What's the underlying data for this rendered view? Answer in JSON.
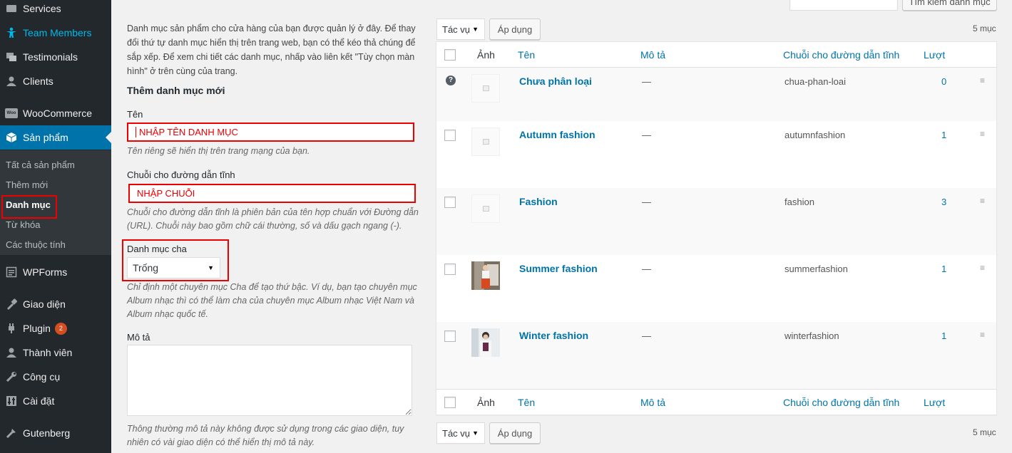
{
  "sidebar": {
    "items": [
      {
        "label": "Services",
        "icon": "services-icon"
      },
      {
        "label": "Team Members",
        "icon": "team-icon"
      },
      {
        "label": "Testimonials",
        "icon": "testimonials-icon"
      },
      {
        "label": "Clients",
        "icon": "clients-icon"
      },
      {
        "label": "WooCommerce",
        "icon": "woocommerce-icon"
      },
      {
        "label": "Sản phẩm",
        "icon": "products-icon"
      },
      {
        "label": "WPForms",
        "icon": "wpforms-icon"
      },
      {
        "label": "Giao diện",
        "icon": "appearance-icon"
      },
      {
        "label": "Plugin",
        "icon": "plugin-icon",
        "badge": "2"
      },
      {
        "label": "Thành viên",
        "icon": "users-icon"
      },
      {
        "label": "Công cụ",
        "icon": "tools-icon"
      },
      {
        "label": "Cài đặt",
        "icon": "settings-icon"
      },
      {
        "label": "Gutenberg",
        "icon": "gutenberg-icon"
      }
    ],
    "submenu": [
      "Tất cả sản phẩm",
      "Thêm mới",
      "Danh mục",
      "Từ khóa",
      "Các thuộc tính"
    ]
  },
  "form": {
    "intro": "Danh mục sản phẩm cho cửa hàng của bạn được quản lý ở đây. Để thay đổi thứ tự danh mục hiển thị trên trang web, bạn có thể kéo thả chúng để sắp xếp. Để xem chi tiết các danh mục, nhấp vào liên kết \"Tùy chọn màn hình\" ở trên cùng của trang.",
    "heading": "Thêm danh mục mới",
    "name_label": "Tên",
    "name_value": "NHẬP TÊN DANH MỤC",
    "name_help": "Tên riêng sẽ hiển thị trên trang mạng của bạn.",
    "slug_label": "Chuỗi cho đường dẫn tĩnh",
    "slug_value": "NHẬP CHUỖI",
    "slug_help": "Chuỗi cho đường dẫn tĩnh là phiên bản của tên hợp chuẩn với Đường dẫn (URL). Chuỗi này bao gồm chữ cái thường, số và dấu gạch ngang (-).",
    "parent_label": "Danh mục cha",
    "parent_value": "Trống",
    "parent_help": "Chỉ định một chuyên mục Cha để tạo thứ bậc. Ví dụ, bạn tạo chuyên mục Album nhạc thì có thể làm cha của chuyên mục Album nhạc Việt Nam và Album nhạc quốc tế.",
    "desc_label": "Mô tả",
    "desc_help": "Thông thường mô tả này không được sử dụng trong các giao diện, tuy nhiên có vài giao diện có thể hiển thị mô tả này."
  },
  "list": {
    "search_button": "Tìm kiếm danh mục",
    "bulk_action": "Tác vụ",
    "apply": "Áp dụng",
    "item_count": "5 mục",
    "columns": {
      "image": "Ảnh",
      "name": "Tên",
      "description": "Mô tả",
      "slug": "Chuỗi cho đường dẫn tĩnh",
      "count": "Lượt"
    },
    "rows": [
      {
        "name": "Chưa phân loại",
        "description": "—",
        "slug": "chua-phan-loai",
        "count": "0",
        "image": "placeholder"
      },
      {
        "name": "Autumn fashion",
        "description": "—",
        "slug": "autumnfashion",
        "count": "1",
        "image": "placeholder"
      },
      {
        "name": "Fashion",
        "description": "—",
        "slug": "fashion",
        "count": "3",
        "image": "placeholder"
      },
      {
        "name": "Summer fashion",
        "description": "—",
        "slug": "summerfashion",
        "count": "1",
        "image": "photo"
      },
      {
        "name": "Winter fashion",
        "description": "—",
        "slug": "winterfashion",
        "count": "1",
        "image": "photo"
      }
    ]
  },
  "colors": {
    "sidebar_bg": "#23282d",
    "accent": "#0073aa",
    "highlight": "#ee0000"
  }
}
